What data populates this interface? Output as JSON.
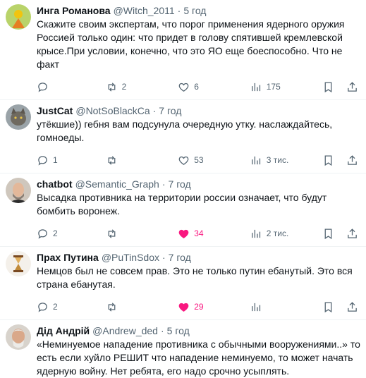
{
  "tweets": [
    {
      "name": "Инга Романова",
      "handle": "@Witch_2011",
      "time": "5 год",
      "text": "Скажите своим экспертам, что порог применения ядерного оружия Россией только один: что придет в голову спятившей кремлевской крысе.При условии, конечно, что это ЯО еще боеспособно. Что не факт",
      "replies": "",
      "retweets": "2",
      "likes": "6",
      "views": "175",
      "liked": false
    },
    {
      "name": "JustCat",
      "handle": "@NotSoBlackCa",
      "time": "7 год",
      "text": "утёкшие)) гебня вам подсунула очередную утку. наслаждайтесь, гомноеды.",
      "replies": "1",
      "retweets": "",
      "likes": "53",
      "views": "3 тис.",
      "liked": false
    },
    {
      "name": "chatbot",
      "handle": "@Semantic_Graph",
      "time": "7 год",
      "text": "Высадка противника на территории россии означает, что будут бомбить воронеж.",
      "replies": "2",
      "retweets": "",
      "likes": "34",
      "views": "2 тис.",
      "liked": true
    },
    {
      "name": "Прах Путина",
      "handle": "@PuTinSdox",
      "time": "7 год",
      "text": "Немцов был не совсем прав. Это не только путин ебанутый. Это вся страна ебанутая.",
      "replies": "2",
      "retweets": "",
      "likes": "29",
      "views": "",
      "liked": true
    },
    {
      "name": "Дід Андрій",
      "handle": "@Andrew_ded",
      "time": "5 год",
      "text": "«Неминуемое нападение противника с обычными вооружениями..» то есть если хуйло РЕШИТ что нападение неминуемо, то может начать ядерную войну. Нет ребята, его надо срочно усыплять.",
      "replies": "",
      "retweets": "",
      "likes": "",
      "views": "",
      "liked": false
    }
  ],
  "colors": {
    "text": "#0f1419",
    "secondary": "#536471",
    "like_active": "#f91880",
    "divider": "#eff3f4"
  },
  "icons": [
    "reply-icon",
    "retweet-icon",
    "like-icon",
    "views-icon",
    "bookmark-icon",
    "share-icon"
  ]
}
